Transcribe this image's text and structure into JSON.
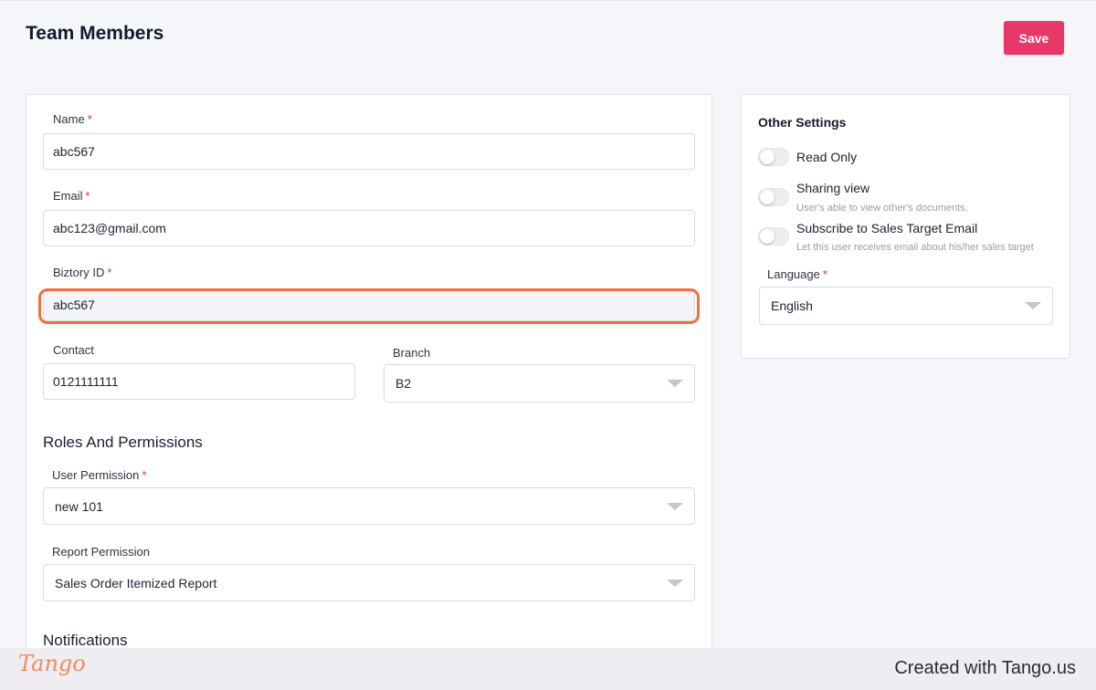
{
  "header": {
    "title": "Team Members",
    "save_label": "Save"
  },
  "form": {
    "name": {
      "label": "Name",
      "value": "abc567"
    },
    "email": {
      "label": "Email",
      "value": "abc123@gmail.com"
    },
    "biztory_id": {
      "label": "Biztory ID",
      "value": "abc567"
    },
    "contact": {
      "label": "Contact",
      "value": "0121111111"
    },
    "branch": {
      "label": "Branch",
      "value": "B2"
    }
  },
  "roles": {
    "title": "Roles And Permissions",
    "user_permission": {
      "label": "User Permission",
      "value": "new 101"
    },
    "report_permission": {
      "label": "Report Permission",
      "value": "Sales Order Itemized Report"
    }
  },
  "notifications": {
    "title": "Notifications"
  },
  "other_settings": {
    "title": "Other Settings",
    "read_only": {
      "label": "Read Only"
    },
    "sharing_view": {
      "label": "Sharing view",
      "hint": "User's able to view other's documents."
    },
    "subscribe": {
      "label": "Subscribe to Sales Target Email",
      "hint": "Let this user receives email about his/her sales target"
    },
    "language": {
      "label": "Language",
      "value": "English"
    }
  },
  "required_mark": "*",
  "footer": {
    "logo": "Tango",
    "created_text": "Created with Tango.us"
  },
  "colors": {
    "accent": "#e8386a",
    "highlight": "#f26f3a"
  }
}
